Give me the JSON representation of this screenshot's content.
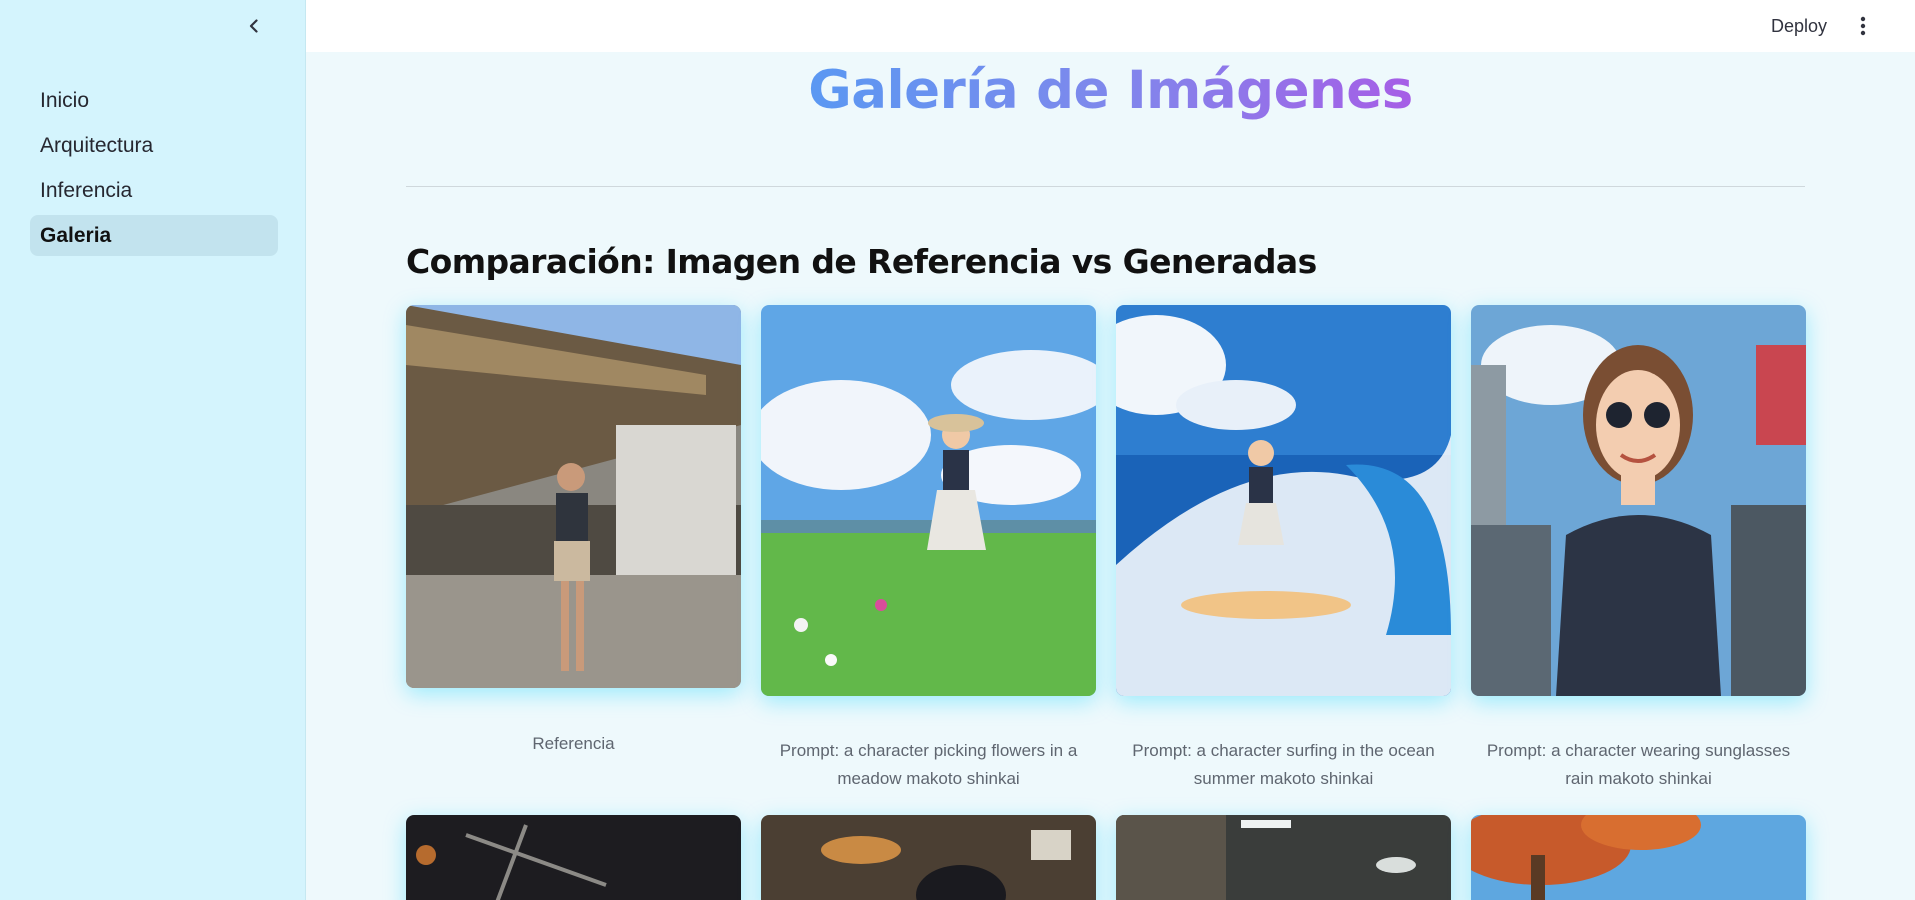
{
  "sidebar": {
    "items": [
      {
        "label": "Inicio",
        "active": false
      },
      {
        "label": "Arquitectura",
        "active": false
      },
      {
        "label": "Inferencia",
        "active": false
      },
      {
        "label": "Galeria",
        "active": true
      }
    ]
  },
  "header": {
    "deploy_label": "Deploy"
  },
  "main": {
    "title": "Galería de Imágenes",
    "section_title": "Comparación: Imagen de Referencia vs Generadas",
    "gallery": [
      {
        "caption": "Referencia"
      },
      {
        "caption": "Prompt: a character picking flowers in a meadow makoto shinkai"
      },
      {
        "caption": "Prompt: a character surfing in the ocean summer makoto shinkai"
      },
      {
        "caption": "Prompt: a character wearing sunglasses rain makoto shinkai"
      }
    ]
  },
  "colors": {
    "sidebar_bg": "#d4f4fd",
    "main_bg": "#eef9fc",
    "title_gradient_start": "#5a98f2",
    "title_gradient_end": "#a65ee6",
    "card_glow": "#00d2ff"
  },
  "icons": {
    "collapse": "chevron-left-icon",
    "menu": "vertical-dots-icon"
  }
}
